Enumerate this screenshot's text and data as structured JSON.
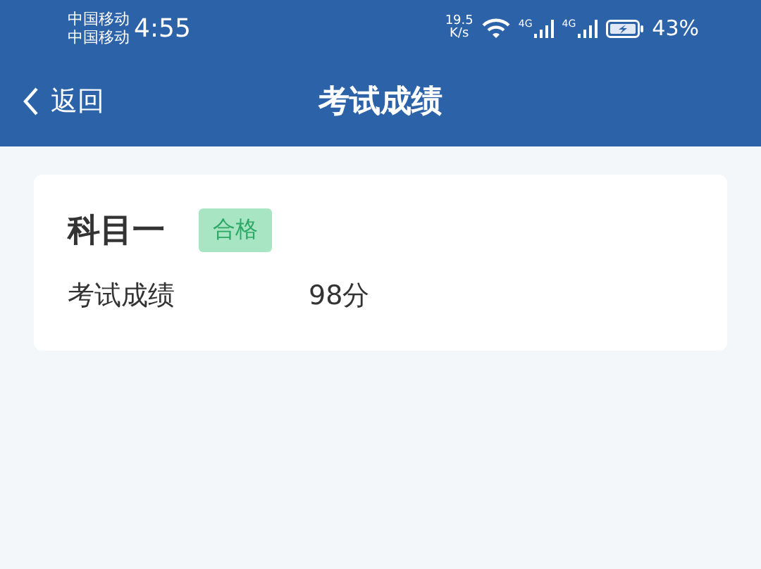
{
  "status_bar": {
    "carriers": [
      "中国移动",
      "中国移动"
    ],
    "time": "4:55",
    "speed": {
      "value": "19.5",
      "unit": "K/s"
    },
    "networks": [
      {
        "label": "4G"
      },
      {
        "label": "4G"
      }
    ],
    "battery": {
      "text": "43%"
    }
  },
  "nav_bar": {
    "back": "返回",
    "title": "考试成绩"
  },
  "results": [
    {
      "subject": "科目一",
      "badge": "合格",
      "label": "考试成绩",
      "score": "98分"
    }
  ]
}
